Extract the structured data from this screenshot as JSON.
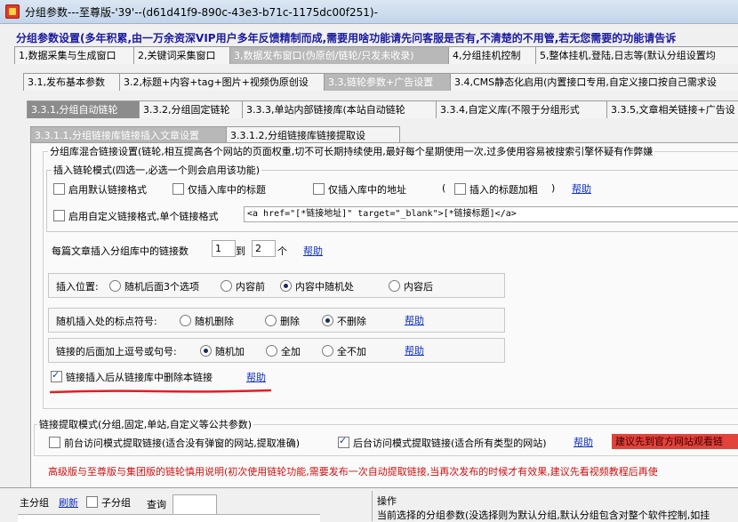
{
  "window": {
    "title": "分组参数---至尊版-'39'--(d61d41f9-890c-43e3-b71c-1175dc00f251)-"
  },
  "banner": "分组参数设置(多年积累,由一万余资深VIP用户多年反馈精制而成,需要用啥功能请先问客服是否有,不清楚的不用管,若无您需要的功能请告诉",
  "tabs1": [
    "1,数据采集与生成窗口",
    "2,关键词采集窗口",
    "3,数据发布窗口(伪原创/链轮/只发未收录)",
    "4,分组挂机控制",
    "5,整体挂机,登陆,日志等(默认分组设置均"
  ],
  "tabs2": [
    "3.1,发布基本参数",
    "3.2,标题+内容+tag+图片+视频伪原创设",
    "3.3,链轮参数+广告设置",
    "3.4,CMS静态化启用(内置接口专用,自定义接口按自己需求设"
  ],
  "tabs3": [
    "3.3.1,分组自动链轮",
    "3.3.2,分组固定链轮",
    "3.3.3,单站内部链接库(本站自动链轮",
    "3.3.4,自定义库(不限于分组形式",
    "3.3.5,文章相关链接+广告设"
  ],
  "tabs4": [
    "3.3.1.1,分组链接库链接插入文章设置",
    "3.3.1.2,分组链接库链接提取设"
  ],
  "mix": {
    "legend": "分组库混合链接设置(链轮,相互提高各个网站的页面权重,切不可长期持续使用,最好每个星期使用一次,过多使用容易被搜索引擎怀疑有作弊嫌",
    "mode_legend": "插入链轮模式(四选一,必选一个则会启用该功能)",
    "opt_default": "启用默认链接格式",
    "opt_title": "仅插入库中的标题",
    "opt_addr": "仅插入库中的地址",
    "bold_open": "(",
    "opt_bold": "插入的标题加粗",
    "bold_close": ")",
    "help": "帮助",
    "opt_custom": "启用自定义链接格式,单个链接格式",
    "custom_value": "<a href=\"[*链接地址]\" target=\"_blank\">[*链接标题]</a>",
    "count_label": "每篇文章插入分组库中的链接数",
    "count_from": "1",
    "count_to_label": "到",
    "count_to": "2",
    "count_unit": "个",
    "pos_label": "插入位置:",
    "pos_opts": [
      "随机后面3个选项",
      "内容前",
      "内容中随机处",
      "内容后"
    ],
    "punct_label": "随机插入处的标点符号:",
    "punct_opts": [
      "随机删除",
      "删除",
      "不删除"
    ],
    "comma_label": "链接的后面加上逗号或句号:",
    "comma_opts": [
      "随机加",
      "全加",
      "全不加"
    ],
    "delete_label": "链接插入后从链接库中删除本链接"
  },
  "extract": {
    "legend": "链接提取模式(分组,固定,单站,自定义等公共参数)",
    "front": "前台访问模式提取链接(适合没有弹窗的网站,提取准确)",
    "back": "后台访问模式提取链接(适合所有类型的网站)",
    "help": "帮助",
    "notice": "建议先到官方网站观看链"
  },
  "footer_red": "高级版与至尊版与集团版的链轮慎用说明(初次使用链轮功能,需要发布一次自动提取链接,当再次发布的时候才有效果,建议先看视频教程后再使",
  "bottom": {
    "main_group": "主分组",
    "refresh": "刷新",
    "sub_group": "子分组",
    "query": "查询",
    "op_label": "操作",
    "op_text": "当前选择的分组参数(没选择则为默认分组,默认分组包含对整个软件控制,如挂"
  },
  "colors": {
    "accent_link": "#1030c0",
    "banner": "#1a1aa0",
    "warning_red": "#d01010"
  }
}
